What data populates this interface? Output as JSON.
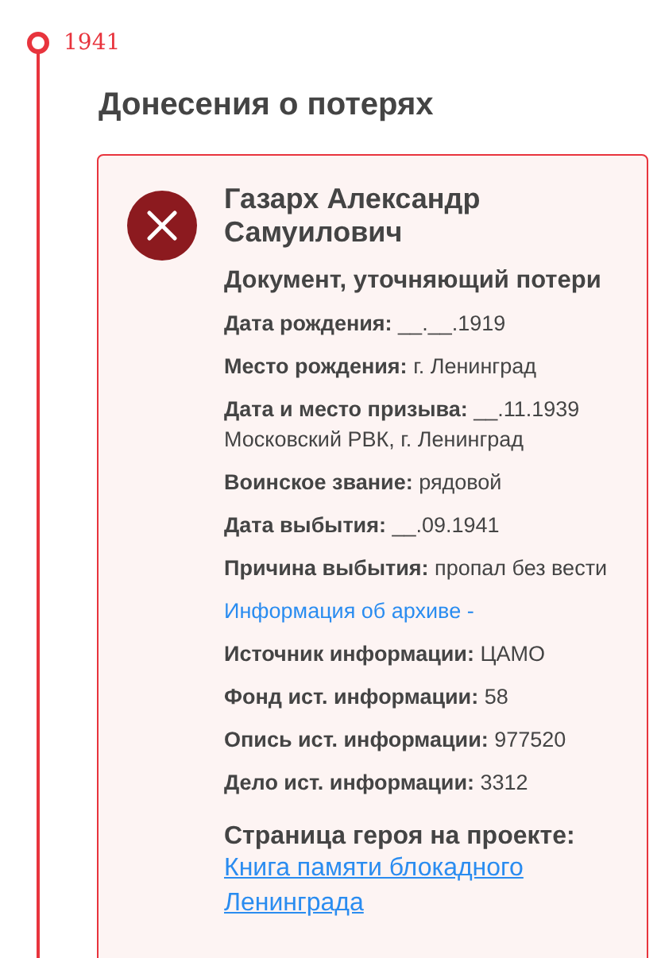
{
  "timeline": {
    "year": "1941"
  },
  "section": {
    "title": "Донесения о потерях"
  },
  "record": {
    "kind": "lost",
    "name": "Газарх Александр Самуилович",
    "document_type": "Документ, уточняющий потери",
    "fields": [
      {
        "kind": "text",
        "text": "**Дата рождения:** __.__.1919"
      },
      {
        "kind": "text",
        "text": "**Место рождения:** г. Ленинград"
      },
      {
        "kind": "text",
        "text": "**Дата и место призыва:** __.11.1939 Московский РВК, г. Ленинград"
      },
      {
        "kind": "text",
        "text": "**Воинское звание:** рядовой"
      },
      {
        "kind": "text",
        "text": "**Дата выбытия:** __.09.1941"
      },
      {
        "kind": "text",
        "text": "**Причина выбытия:** пропал без вести"
      },
      {
        "kind": "link",
        "text": "Информация об архиве -"
      },
      {
        "kind": "text",
        "text": "**Источник информации:** ЦАМО"
      },
      {
        "kind": "text",
        "text": "**Фонд ист. информации:** 58"
      },
      {
        "kind": "text",
        "text": "**Опись ист. информации:** 977520"
      },
      {
        "kind": "text",
        "text": "**Дело ист. информации:** 3312"
      }
    ],
    "hero_page": {
      "title": "Страница героя на проекте:",
      "link": "Книга памяти блокадного Ленинграда"
    }
  }
}
